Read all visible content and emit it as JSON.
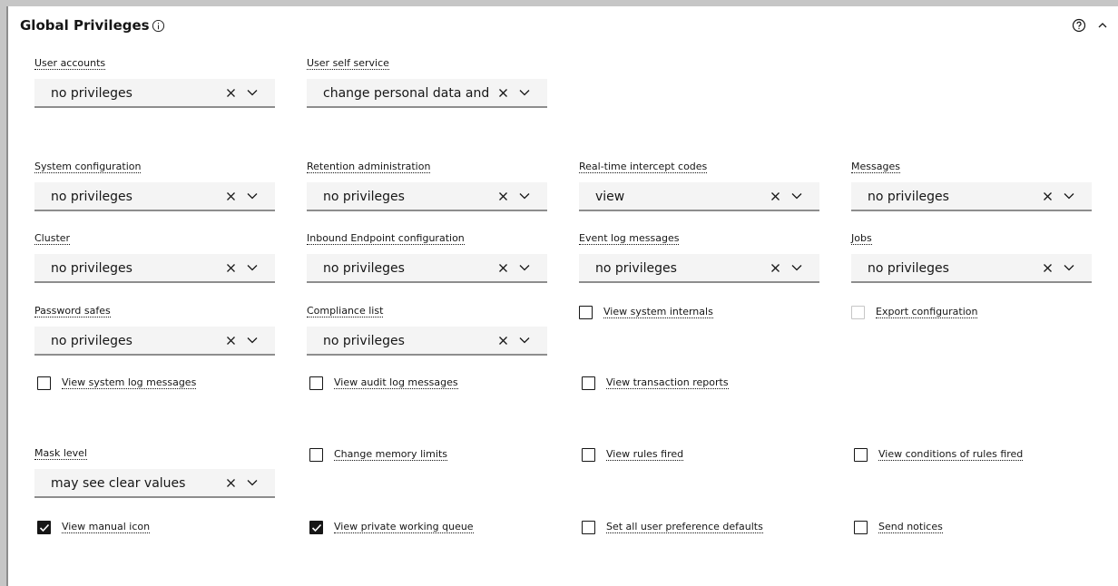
{
  "panel": {
    "title": "Global Privileges"
  },
  "icons": {
    "info": "info-icon",
    "help": "help-icon",
    "collapse": "chevron-up-icon",
    "clear": "close-icon",
    "expand": "chevron-down-icon",
    "check": "checkmark-icon"
  },
  "selects": {
    "user_accounts": {
      "label": "User accounts",
      "value": "no privileges"
    },
    "user_self_service": {
      "label": "User self service",
      "value": "change personal data and"
    },
    "system_configuration": {
      "label": "System configuration",
      "value": "no privileges"
    },
    "retention_administration": {
      "label": "Retention administration",
      "value": "no privileges"
    },
    "realtime_intercept_codes": {
      "label": "Real-time intercept codes",
      "value": "view"
    },
    "messages": {
      "label": "Messages",
      "value": "no privileges"
    },
    "cluster": {
      "label": "Cluster",
      "value": "no privileges"
    },
    "inbound_endpoint_configuration": {
      "label": "Inbound Endpoint configuration",
      "value": "no privileges"
    },
    "event_log_messages": {
      "label": "Event log messages",
      "value": "no privileges"
    },
    "jobs": {
      "label": "Jobs",
      "value": "no privileges"
    },
    "password_safes": {
      "label": "Password safes",
      "value": "no privileges"
    },
    "compliance_list": {
      "label": "Compliance list",
      "value": "no privileges"
    },
    "mask_level": {
      "label": "Mask level",
      "value": "may see clear values"
    }
  },
  "checkboxes": {
    "view_system_internals": {
      "label": "View system internals",
      "checked": false
    },
    "export_configuration": {
      "label": "Export configuration",
      "checked": false,
      "disabled": true
    },
    "view_system_log_messages": {
      "label": "View system log messages",
      "checked": false
    },
    "view_audit_log_messages": {
      "label": "View audit log messages",
      "checked": false
    },
    "view_transaction_reports": {
      "label": "View transaction reports",
      "checked": false
    },
    "change_memory_limits": {
      "label": "Change memory limits",
      "checked": false
    },
    "view_rules_fired": {
      "label": "View rules fired",
      "checked": false
    },
    "view_conditions_of_rules_fired": {
      "label": "View conditions of rules fired",
      "checked": false
    },
    "view_manual_icon": {
      "label": "View manual icon",
      "checked": true
    },
    "view_private_working_queue": {
      "label": "View private working queue",
      "checked": true
    },
    "set_all_user_preference_defaults": {
      "label": "Set all user preference defaults",
      "checked": false
    },
    "send_notices": {
      "label": "Send notices",
      "checked": false
    }
  }
}
